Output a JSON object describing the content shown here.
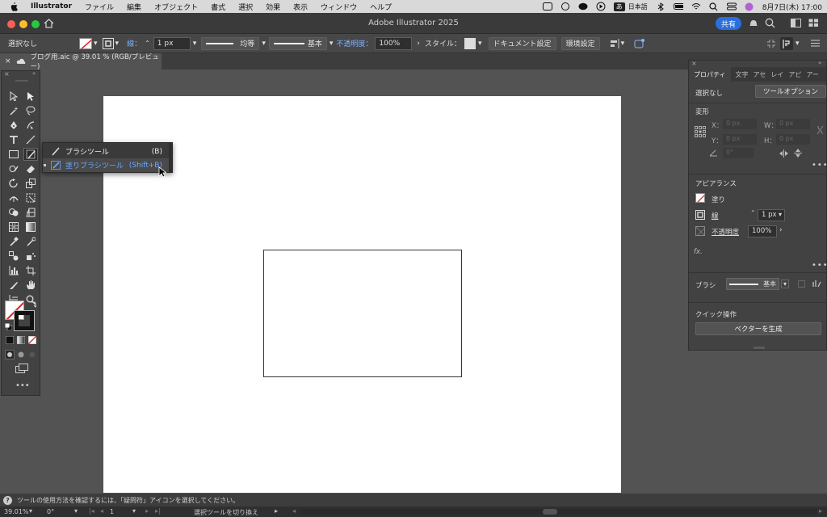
{
  "menubar": {
    "app": "Illustrator",
    "items": [
      "ファイル",
      "編集",
      "オブジェクト",
      "書式",
      "選択",
      "効果",
      "表示",
      "ウィンドウ",
      "ヘルプ"
    ],
    "input_mode": "あ",
    "input_lang": "日本語",
    "datetime": "8月7日(木) 17:00"
  },
  "header": {
    "title": "Adobe Illustrator 2025",
    "share": "共有"
  },
  "control": {
    "selection": "選択なし",
    "stroke_label": "線：",
    "stroke_value": "1 px",
    "profile": "均等",
    "brush": "基本",
    "opacity_label": "不透明度：",
    "opacity_value": "100%",
    "style_label": "スタイル：",
    "doc_setup": "ドキュメント設定",
    "prefs": "環境設定"
  },
  "tab": {
    "title": "ブログ用.aic @ 39.01 % (RGB/プレビュー)"
  },
  "flyout": {
    "items": [
      {
        "label": "ブラシツール",
        "shortcut": "(B)"
      },
      {
        "label": "塗りブラシツール",
        "shortcut": "(Shift+B)"
      }
    ]
  },
  "panel": {
    "tabs": [
      "プロパティ",
      "文字",
      "アセ",
      "レイ",
      "アピ",
      "アー"
    ],
    "selection": "選択なし",
    "tool_options": "ツールオプション",
    "transform": "変形",
    "x_label": "X：",
    "y_label": "Y：",
    "w_label": "W：",
    "h_label": "H：",
    "x_val": "0 px",
    "y_val": "0 px",
    "w_val": "0 px",
    "h_val": "0 px",
    "angle_val": "0°",
    "appearance": "アピアランス",
    "fill_label": "塗り",
    "stroke_label": "線",
    "stroke_value": "1 px",
    "opacity_label": "不透明度",
    "opacity_value": "100%",
    "fx": "fx.",
    "brush_label": "ブラシ",
    "brush_value": "基本",
    "quick_actions": "クイック操作",
    "vectorize": "ベクターを生成"
  },
  "hint": "ツールの使用方法を確認するには、「疑問符」アイコンを選択してください。",
  "status": {
    "zoom": "39.01%",
    "rotate": "0°",
    "artboard": "1",
    "tool_info": "選択ツールを切り換え"
  },
  "colors": {
    "accent": "#2b6fdc",
    "flyout_highlight": "#6aa7ff",
    "canvas_bg": "#535353"
  }
}
